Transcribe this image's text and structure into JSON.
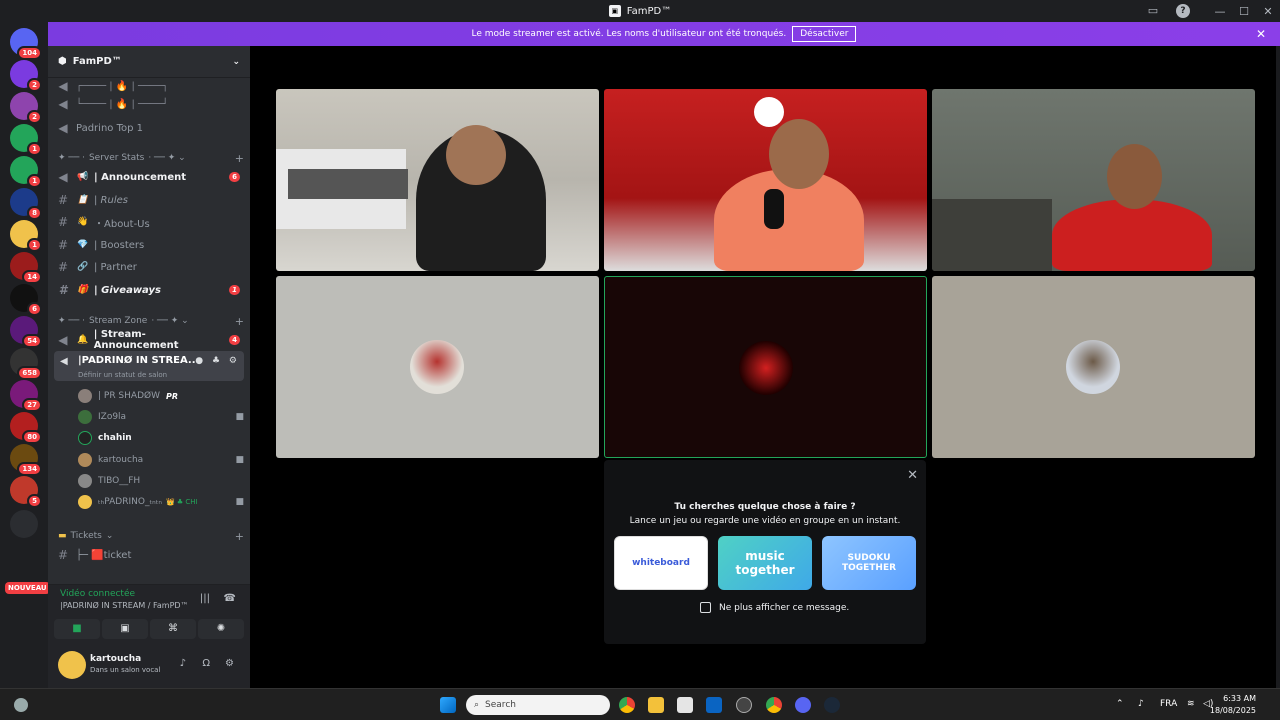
{
  "window": {
    "title": "FamPD™"
  },
  "banner": {
    "text": "Le mode streamer est activé. Les noms d'utilisateur ont été tronqués.",
    "button": "Désactiver"
  },
  "guilds": [
    {
      "badge": "104",
      "color": "#5865f2"
    },
    {
      "badge": "2",
      "color": "#7b3be0"
    },
    {
      "badge": "2",
      "color": "#8e44ad"
    },
    {
      "badge": "1",
      "color": "#23a55a"
    },
    {
      "badge": "1",
      "color": "#23a55a"
    },
    {
      "badge": "8",
      "color": "#1c3b8a"
    },
    {
      "badge": "1",
      "color": "#f0c24b"
    },
    {
      "badge": "14",
      "color": "#9b1c1c"
    },
    {
      "badge": "6",
      "color": "#111111"
    },
    {
      "badge": "54",
      "color": "#5a1a7a"
    },
    {
      "badge": "658",
      "color": "#333333"
    },
    {
      "badge": "27",
      "color": "#7a1a7a"
    },
    {
      "badge": "80",
      "color": "#b31f1f"
    },
    {
      "badge": "134",
      "color": "#6b4a10"
    },
    {
      "badge": "5",
      "color": "#c0392b"
    }
  ],
  "guild_new_label": "NOUVEAU",
  "server": {
    "name": "FamPD™"
  },
  "channels_top": [
    {
      "label": "Padrino Top 1"
    }
  ],
  "categories": {
    "stats": "Server Stats",
    "stream": "Stream Zone",
    "tickets": "Tickets"
  },
  "channels": [
    {
      "emoji": "📢",
      "label": "| Announcement",
      "badge": "6"
    },
    {
      "emoji": "📋",
      "label": "| Rules"
    },
    {
      "emoji": "👋",
      "label": "・About-Us"
    },
    {
      "emoji": "💎",
      "label": "| Boosters"
    },
    {
      "emoji": "🔗",
      "label": "| Partner"
    },
    {
      "emoji": "🎁",
      "label": "| Giveaways",
      "badge": "1"
    }
  ],
  "stream_channels": [
    {
      "emoji": "🔔",
      "label": "| Stream-Announcement",
      "badge": "4"
    }
  ],
  "voice_channel": {
    "name": "|PADRINØ IN STREA...",
    "status": "Définir un statut de salon"
  },
  "voice_users": [
    {
      "name": "| PR SHADØW",
      "tag": "PR"
    },
    {
      "name": "IZo9la"
    },
    {
      "name": "chahin"
    },
    {
      "name": "kartoucha"
    },
    {
      "name": "TIBO__FH"
    },
    {
      "name": "ₜₕPADRINO_ₜₙₜₙ"
    }
  ],
  "ticket_channel": {
    "label": "├─ 🟥ticket"
  },
  "rtc": {
    "status": "Vidéo connectée",
    "location": "|PADRINØ IN STREAM / FamPD™"
  },
  "user": {
    "name": "kartoucha",
    "status": "Dans un salon vocal"
  },
  "popup": {
    "title": "Tu cherches quelque chose à faire ?",
    "subtitle": "Lance un jeu ou regarde une vidéo en groupe en un instant.",
    "activities": [
      {
        "name": "whiteboard",
        "bg": "#ffffff",
        "fg": "#3a5bd9"
      },
      {
        "name": "music together",
        "bg": "#4fd1c5",
        "fg": "#ffffff"
      },
      {
        "name": "SUDOKU TOGETHER",
        "bg": "#8ec5ff",
        "fg": "#ffffff"
      }
    ],
    "checkbox": "Ne plus afficher ce message."
  },
  "taskbar": {
    "search": "Search",
    "lang": "FRA",
    "time": "6:33 AM",
    "date": "18/08/2025"
  }
}
